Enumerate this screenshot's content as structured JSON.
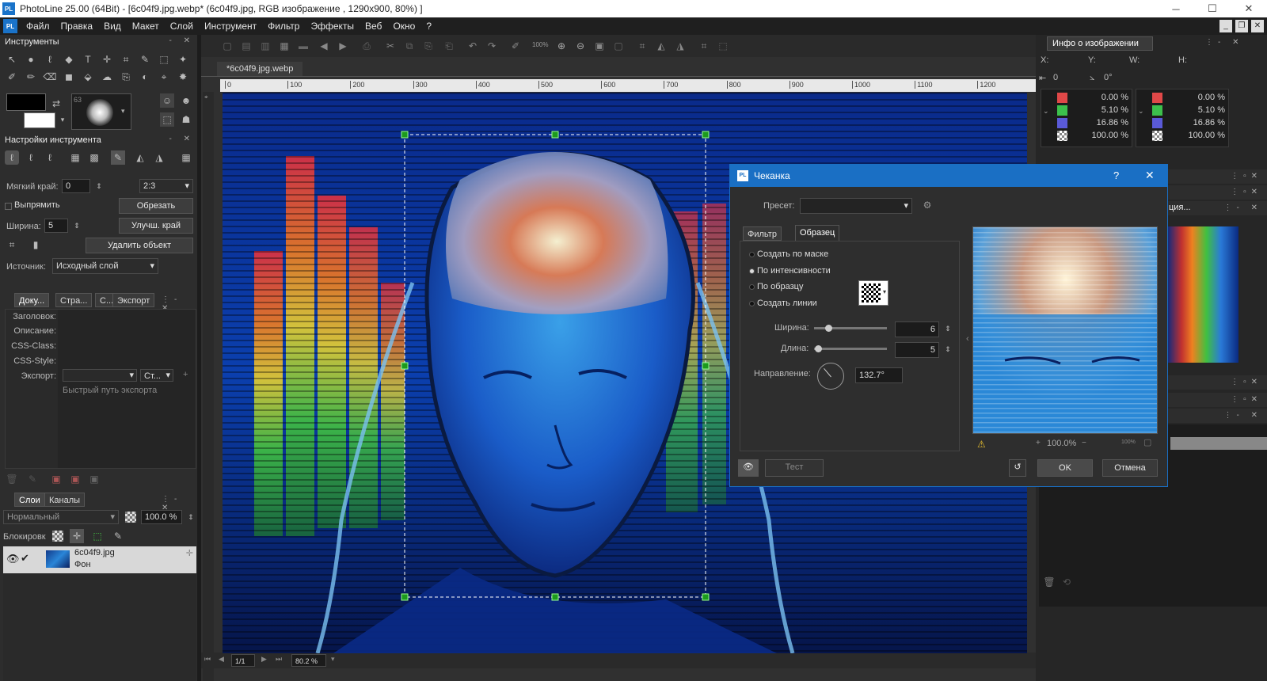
{
  "window": {
    "logo": "PL",
    "title": "PhotoLine 25.00 (64Bit) - [6c04f9.jpg.webp* (6c04f9.jpg, RGB изображение , 1290x900, 80%) ]",
    "minimize": "─",
    "maximize": "☐",
    "close": "✕"
  },
  "menu": {
    "items": [
      "Файл",
      "Правка",
      "Вид",
      "Макет",
      "Слой",
      "Инструмент",
      "Фильтр",
      "Эффекты",
      "Веб",
      "Окно",
      "?"
    ],
    "mdi_min": "_",
    "mdi_restore": "❐",
    "mdi_close": "✕"
  },
  "tools_panel": {
    "title": "Инструменты",
    "brush_size": "63"
  },
  "tool_settings": {
    "title": "Настройки инструмента",
    "soft_edge_label": "Мягкий край:",
    "soft_edge_value": "0",
    "ratio_value": "2:3",
    "straighten_label": "Выпрямить",
    "crop_button": "Обрезать",
    "width_label": "Ширина:",
    "width_value": "5",
    "improve_edge_button": "Улучш. край",
    "remove_object_button": "Удалить объект",
    "source_label": "Источник:",
    "source_value": "Исходный слой"
  },
  "doc_panel": {
    "tabs": [
      "Доку...",
      "Стра...",
      "С...",
      "Экспорт"
    ],
    "rows": [
      "Заголовок:",
      "Описание:",
      "CSS-Class:",
      "CSS-Style:"
    ],
    "export_label": "Экспорт:",
    "export_sub": "Ст...",
    "quick_path": "Быстрый путь экспорта"
  },
  "layers_panel": {
    "tabs": [
      "Слои",
      "Каналы"
    ],
    "blend_mode": "Нормальный",
    "opacity": "100.0 %",
    "lock_label": "Блокировк",
    "layer_name": "6c04f9.jpg",
    "layer_sub": "Фон"
  },
  "document": {
    "tab": "*6c04f9.jpg.webp",
    "zoom_toolbar": "100%",
    "page": "1/1",
    "zoom": "80.2 %",
    "ruler_marks": [
      "0",
      "100",
      "200",
      "300",
      "400",
      "500",
      "600",
      "700",
      "800",
      "900",
      "1000",
      "1100",
      "1200"
    ]
  },
  "info_panel": {
    "title": "Инфо о изображении",
    "x_label": "X:",
    "y_label": "Y:",
    "w_label": "W:",
    "h_label": "H:",
    "offset_value": "0",
    "angle_value": "0°",
    "channels_left": [
      "0.00 %",
      "5.10 %",
      "16.86 %",
      "100.00 %"
    ],
    "channels_right": [
      "0.00 %",
      "5.10 %",
      "16.86 %",
      "100.00 %"
    ],
    "channel_colors": [
      "#e04848",
      "#3cc04c",
      "#5a5ad8",
      "#ffffff"
    ],
    "partial_tab": "ция..."
  },
  "dialog": {
    "logo": "PL",
    "title": "Чеканка",
    "help": "?",
    "close": "✕",
    "preset_label": "Пресет:",
    "tabs": [
      "Фильтр",
      "Образец"
    ],
    "options": [
      "Создать по маске",
      "По интенсивности",
      "По образцу",
      "Создать линии"
    ],
    "selected_option": 1,
    "width_label": "Ширина:",
    "width_value": "6",
    "width_level": 0.2,
    "length_label": "Длина:",
    "length_value": "5",
    "length_level": 0.05,
    "direction_label": "Направление:",
    "direction_value": "132.7°",
    "preview_zoom": "100.0%",
    "preview_zoom_small": "100%",
    "test_button": "Тест",
    "ok_button": "OK",
    "cancel_button": "Отмена"
  }
}
